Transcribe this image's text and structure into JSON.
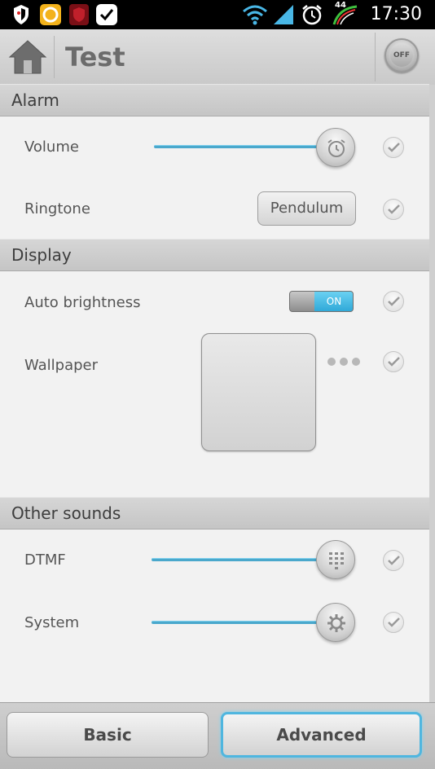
{
  "status_bar": {
    "time": "17:30",
    "battery_level": "44",
    "icons": [
      "shield-icon",
      "circle-app-icon",
      "red-shield-icon",
      "check-badge-icon",
      "wifi-icon",
      "signal-icon",
      "alarm-clock-icon",
      "battery-icon"
    ]
  },
  "title_bar": {
    "title": "Test",
    "power_toggle_label": "OFF"
  },
  "sections": {
    "alarm": {
      "header": "Alarm",
      "volume_label": "Volume",
      "volume_level": 1.0,
      "ringtone_label": "Ringtone",
      "ringtone_value": "Pendulum"
    },
    "display": {
      "header": "Display",
      "auto_brightness_label": "Auto brightness",
      "auto_brightness_state": "ON",
      "wallpaper_label": "Wallpaper"
    },
    "other_sounds": {
      "header": "Other sounds",
      "dtmf_label": "DTMF",
      "dtmf_level": 1.0,
      "system_label": "System",
      "system_level": 1.0
    }
  },
  "bottom_bar": {
    "basic_label": "Basic",
    "advanced_label": "Advanced",
    "active_tab": "Advanced"
  },
  "colors": {
    "accent": "#4aa8cc",
    "status_bar_bg": "#000000",
    "panel_bg": "#f2f2f2",
    "header_bg": "#cdcdcd"
  }
}
